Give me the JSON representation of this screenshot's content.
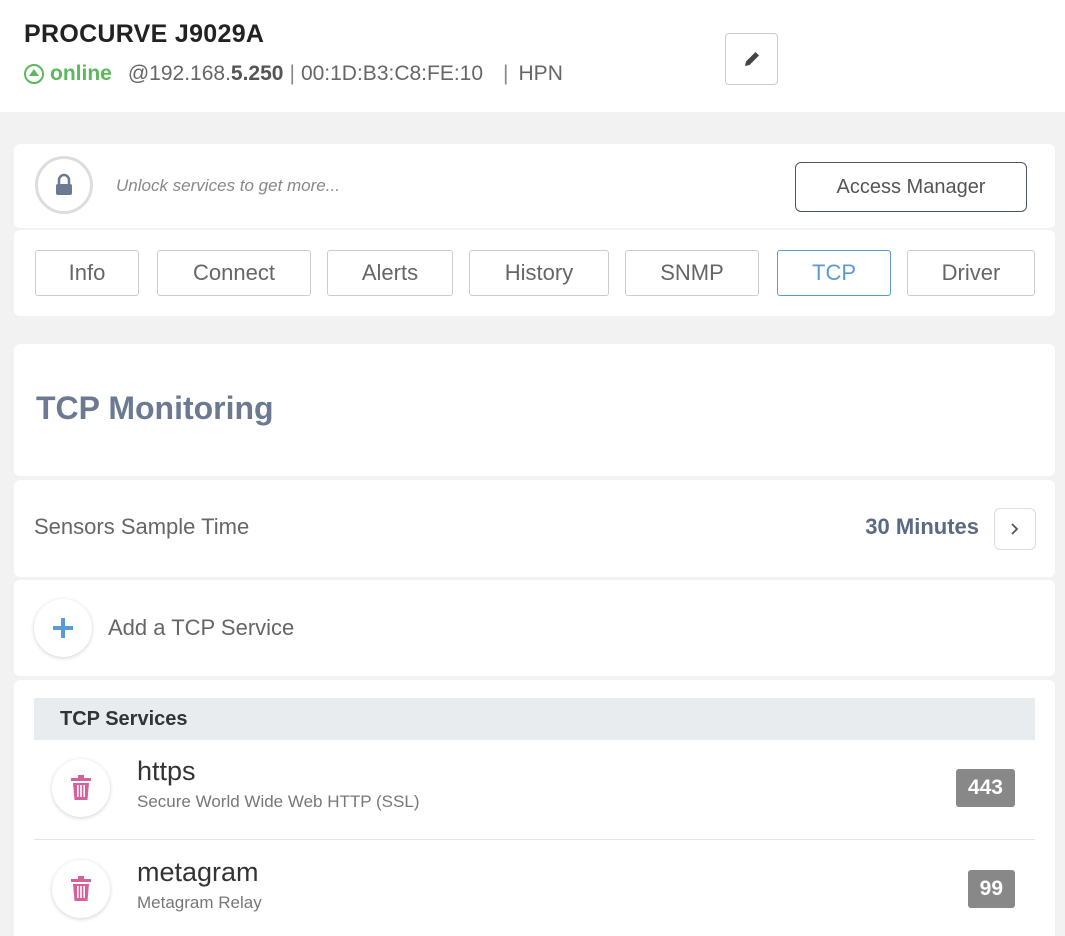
{
  "device": {
    "name": "PROCURVE J9029A",
    "status": "online",
    "ip_prefix": "@192.168.",
    "ip_suffix": "5.250",
    "separator": "|",
    "mac": "00:1D:B3:C8:FE:10",
    "vendor": "HPN"
  },
  "lock_banner": {
    "text": "Unlock services to get more...",
    "button": "Access Manager"
  },
  "tabs": [
    {
      "label": "Info"
    },
    {
      "label": "Connect"
    },
    {
      "label": "Alerts"
    },
    {
      "label": "History"
    },
    {
      "label": "SNMP"
    },
    {
      "label": "TCP",
      "active": true
    },
    {
      "label": "Driver"
    }
  ],
  "main": {
    "title": "TCP Monitoring",
    "sample_time_label": "Sensors Sample Time",
    "sample_time_value": "30 Minutes",
    "add_service_label": "Add a TCP Service",
    "services_header": "TCP Services",
    "services": [
      {
        "name": "https",
        "description": "Secure World Wide Web HTTP (SSL)",
        "port": "443"
      },
      {
        "name": "metagram",
        "description": "Metagram Relay",
        "port": "99"
      }
    ]
  },
  "colors": {
    "online": "#5cb85c",
    "active_tab": "#5b9bd5",
    "title": "#6b7a90",
    "trash": "#d6609a",
    "plus": "#5b9bd5",
    "badge": "#888888"
  },
  "icons": [
    "online-status-icon",
    "pencil-icon",
    "lock-icon",
    "chevron-right-icon",
    "plus-icon",
    "trash-icon"
  ]
}
